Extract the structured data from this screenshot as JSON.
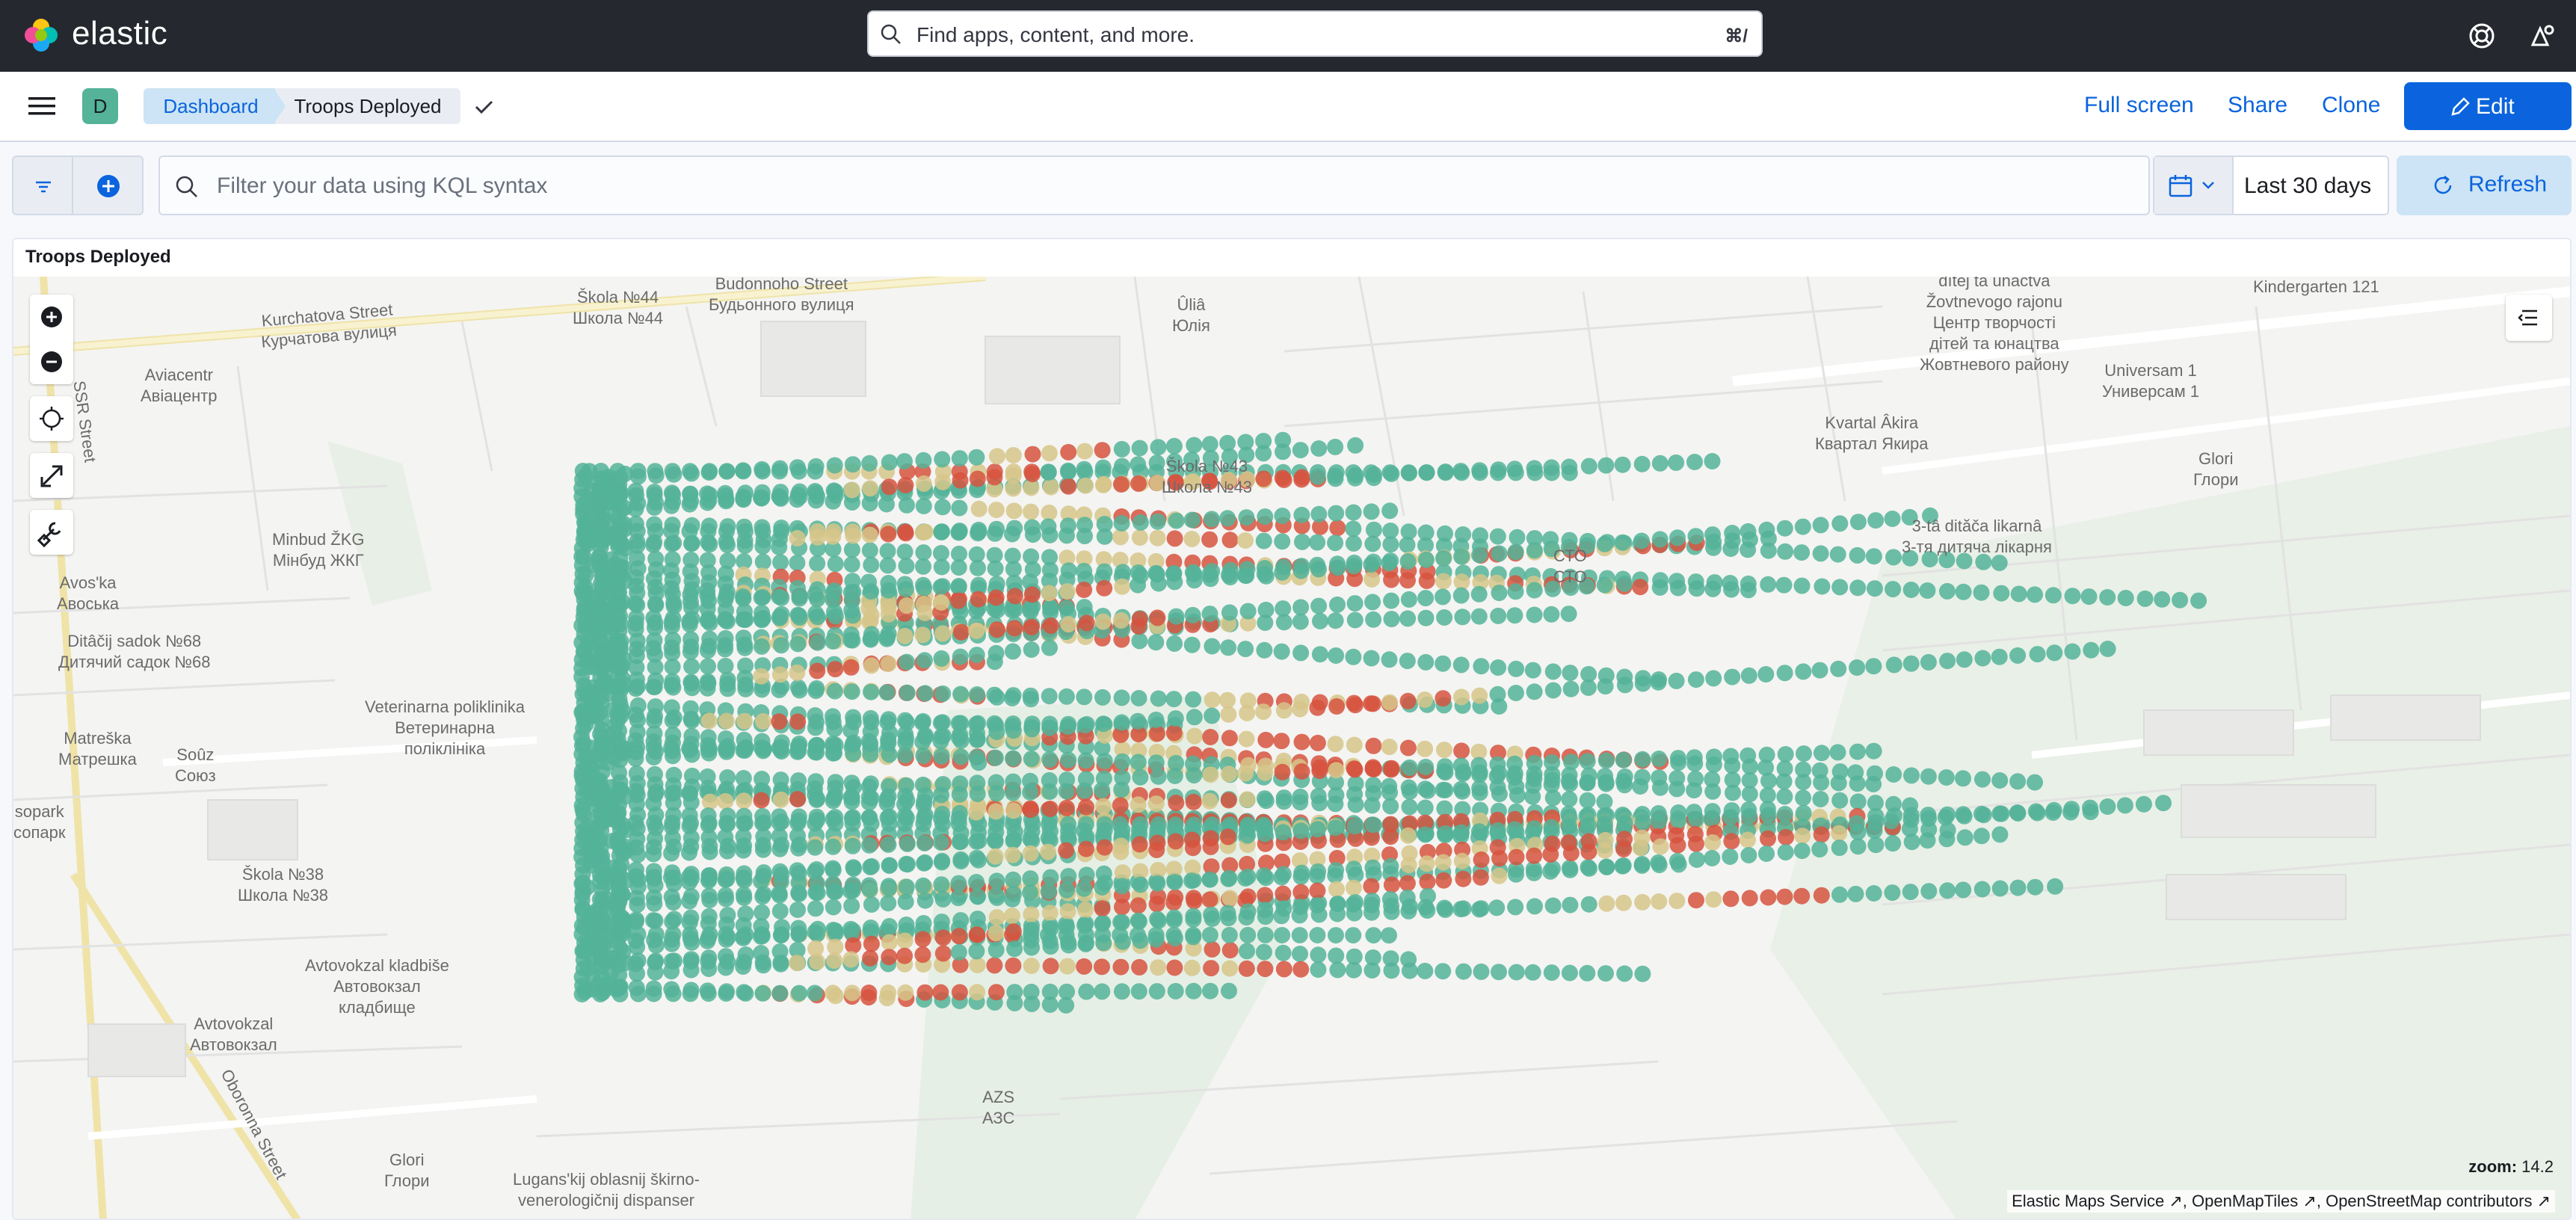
{
  "header": {
    "app_name": "elastic",
    "search_placeholder": "Find apps, content, and more.",
    "search_shortcut": "⌘/"
  },
  "subheader": {
    "avatar_letter": "D",
    "breadcrumbs": [
      "Dashboard",
      "Troops Deployed"
    ],
    "actions": {
      "fullscreen": "Full screen",
      "share": "Share",
      "clone": "Clone",
      "edit": "Edit"
    }
  },
  "filter": {
    "kql_placeholder": "Filter your data using KQL syntax",
    "date_range": "Last 30 days",
    "refresh_label": "Refresh"
  },
  "panel": {
    "title": "Troops Deployed",
    "zoom_label": "zoom:",
    "zoom_value": "14.2",
    "attribution": [
      "Elastic Maps Service",
      "OpenMapTiles",
      "OpenStreetMap contributors"
    ]
  },
  "map_labels": [
    "Škola №44\nШкола №44",
    "Budonnoho Street\nБудьонного вулиця",
    "Kurchatova Street\nКурчатова вулиця",
    "Aviacentr\nАвіацентр",
    "Minbud ŽKG\nМінбуд ЖКГ",
    "Avos'ka\nАвоська",
    "Ditâčij sadok №68\nДитячий садок №68",
    "Veterinarna poliklinika\nВетеринарна\nполіклініка",
    "Matreška\nМатрешка",
    "Soûz\nСоюз",
    "sopark\nсопарк",
    "Škola №38\nШкола №38",
    "Avtovokzal kladbiše\nАвтовокзал\nкладбище",
    "Avtovokzal\nАвтовокзал",
    "Oboronna Street",
    "Glori\nГлори",
    "Lugans'kij oblasnij škirno-\nvenerologičnij dispanser",
    "AZS\nАЗС",
    "Ûliâ\nЮлія",
    "Škola №43\nШкола №43",
    "Kvartal Âkira\nКвартал Якира",
    "dìtej ta ûnactva\nŽovtnevogo rajonu\nЦентр творчості\nдітей та юнацтва\nЖовтневого району",
    "Kindergarten 121",
    "Universam 1\nУниверсам 1",
    "Glori\nГлори",
    "3-tâ dităča likarnâ\n3-тя дитяча лікарня",
    "СТО\nСТО",
    "SSR Street"
  ],
  "colors": {
    "dot_green": "#54b399",
    "dot_red": "#d6533f",
    "dot_yellow": "#d6c58a",
    "brand_blue": "#0b64dd",
    "header_bg": "#25282f"
  }
}
